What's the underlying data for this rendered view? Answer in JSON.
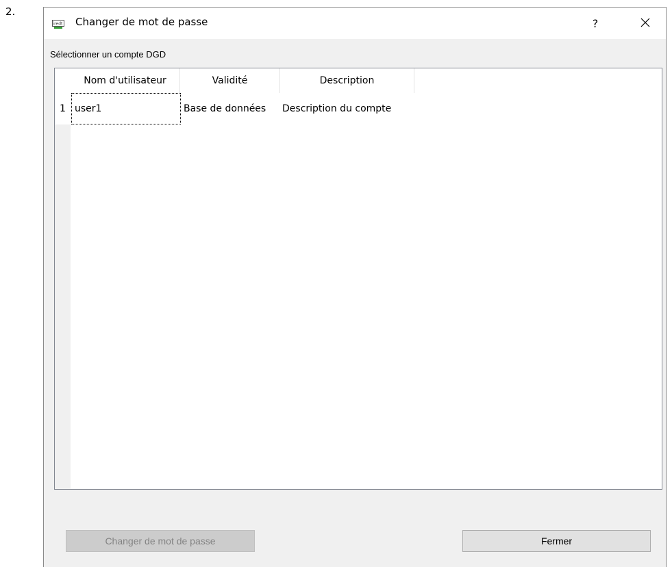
{
  "step_label": "2.",
  "window": {
    "title": "Changer de mot de passe",
    "help_label": "?",
    "close_icon": "close-icon",
    "app_icon": "app-icon"
  },
  "group_label": "Sélectionner un compte DGD",
  "table": {
    "columns": [
      "Nom d'utilisateur",
      "Validité",
      "Description"
    ],
    "rows": [
      {
        "num": "1",
        "cells": [
          "user1",
          "Base de données",
          "Description du compte"
        ]
      }
    ]
  },
  "buttons": {
    "change_password": "Changer de mot de passe",
    "close": "Fermer"
  },
  "colors": {
    "window_bg": "#f0f0f0",
    "border": "#828790",
    "disabled_text": "#838383"
  }
}
